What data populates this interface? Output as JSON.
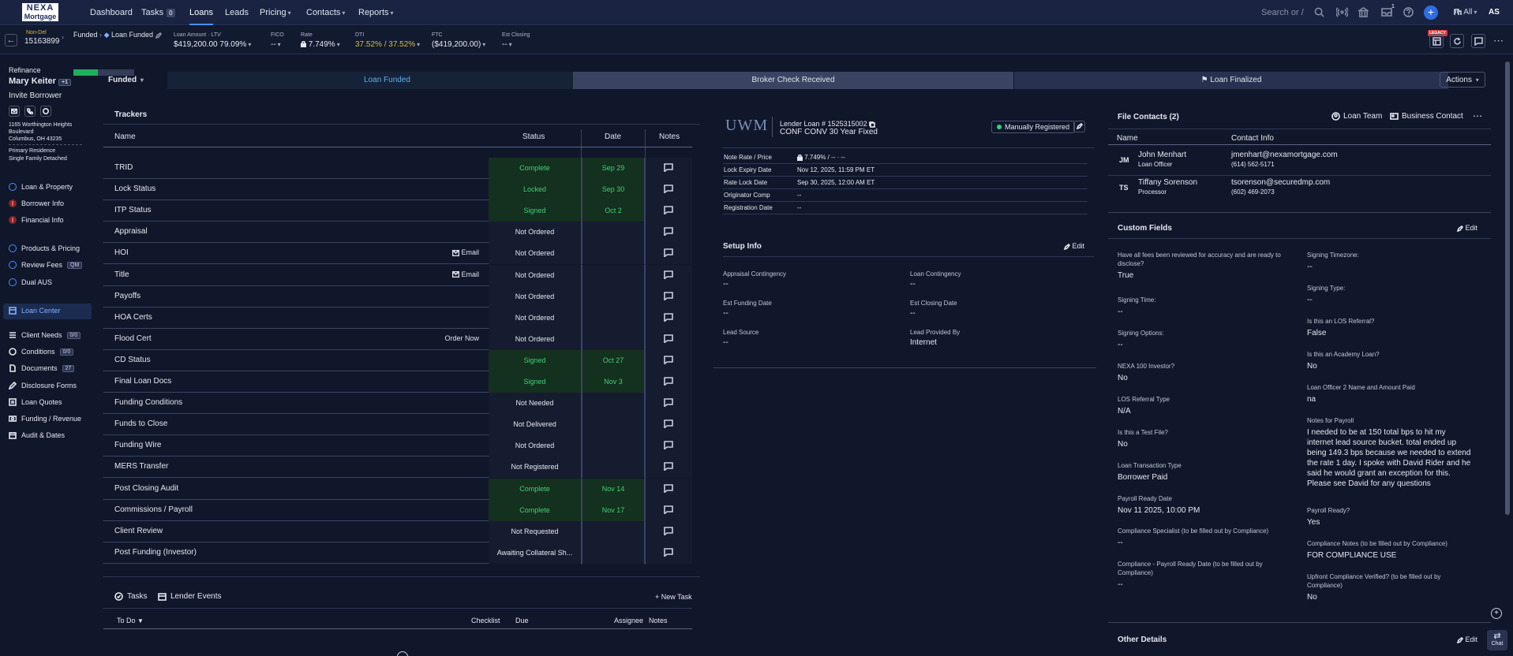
{
  "nav": {
    "logo": "NEXA",
    "logo_sub": "Mortgage",
    "items": [
      {
        "label": "Dashboard",
        "name": "nav-dashboard"
      },
      {
        "label": "Tasks",
        "name": "nav-tasks",
        "count": "0"
      },
      {
        "label": "Loans",
        "name": "nav-loans"
      },
      {
        "label": "Leads",
        "name": "nav-leads"
      },
      {
        "label": "Pricing",
        "name": "nav-pricing"
      },
      {
        "label": "Contacts",
        "name": "nav-contacts"
      },
      {
        "label": "Reports",
        "name": "nav-reports"
      }
    ],
    "search_placeholder": "Search or /",
    "scope": "All",
    "user_initials": "AS",
    "notif_count": "1"
  },
  "loan": {
    "tag": "Non-Del",
    "number": "15163899",
    "stage_path": "Funded",
    "stage_current": "Loan Funded",
    "progress_pct": 40,
    "fields": [
      {
        "label": "Loan Amount  ·  LTV",
        "value": "$419,200.00  79.09%"
      },
      {
        "label": "FICO",
        "value": "--"
      },
      {
        "label": "Rate",
        "value": "7.749%"
      },
      {
        "label": "DTI",
        "value": "37.52% / 37.52%"
      },
      {
        "label": "FTC",
        "value": "($419,200.00)"
      },
      {
        "label": "Est Closing",
        "value": "--"
      }
    ],
    "legacy": "LEGACY"
  },
  "borrower": {
    "purpose": "Refinance",
    "name": "Mary Keiter",
    "extra": "+1",
    "invite": "Invite Borrower",
    "addr1": "1165 Worthington Heights",
    "addr2": "Boulevard",
    "addr3": "Columbus, OH 43235",
    "occupancy": "Primary Residence",
    "property_type": "Single Family Detached"
  },
  "sidebar": {
    "group1": [
      "Loan & Property",
      "Borrower Info",
      "Financial Info"
    ],
    "group2": [
      "Products & Pricing",
      "Review Fees",
      "Dual AUS"
    ],
    "review_badge": "QM",
    "loan_center": "Loan Center",
    "group3": [
      {
        "label": "Client Needs",
        "count": "0/0"
      },
      {
        "label": "Conditions",
        "count": "0/0"
      },
      {
        "label": "Documents",
        "count": "27"
      },
      {
        "label": "Disclosure Forms"
      },
      {
        "label": "Loan Quotes"
      },
      {
        "label": "Funding / Revenue"
      },
      {
        "label": "Audit & Dates"
      }
    ]
  },
  "stages": {
    "dropdown": "Funded",
    "s1": "Loan Funded",
    "s2": "Broker Check Received",
    "s3": "Loan Finalized",
    "actions": "Actions"
  },
  "trackers": {
    "title": "Trackers",
    "headers": {
      "name": "Name",
      "status": "Status",
      "date": "Date",
      "notes": "Notes"
    },
    "rows": [
      {
        "name": "TRID",
        "status": "Complete",
        "date": "Sep 29",
        "green": true
      },
      {
        "name": "Lock Status",
        "status": "Locked",
        "date": "Sep 30",
        "green": true
      },
      {
        "name": "ITP Status",
        "status": "Signed",
        "date": "Oct 2",
        "green": true
      },
      {
        "name": "Appraisal",
        "status": "Not Ordered",
        "date": ""
      },
      {
        "name": "HOI",
        "status": "Not Ordered",
        "date": "",
        "action": "Email"
      },
      {
        "name": "Title",
        "status": "Not Ordered",
        "date": "",
        "action": "Email"
      },
      {
        "name": "Payoffs",
        "status": "Not Ordered",
        "date": ""
      },
      {
        "name": "HOA Certs",
        "status": "Not Ordered",
        "date": ""
      },
      {
        "name": "Flood Cert",
        "status": "Not Ordered",
        "date": "",
        "action": "Order Now"
      },
      {
        "name": "CD Status",
        "status": "Signed",
        "date": "Oct 27",
        "green": true
      },
      {
        "name": "Final Loan Docs",
        "status": "Signed",
        "date": "Nov 3",
        "green": true
      },
      {
        "name": "Funding Conditions",
        "status": "Not Needed",
        "date": ""
      },
      {
        "name": "Funds to Close",
        "status": "Not Delivered",
        "date": ""
      },
      {
        "name": "Funding Wire",
        "status": "Not Ordered",
        "date": ""
      },
      {
        "name": "MERS Transfer",
        "status": "Not Registered",
        "date": ""
      },
      {
        "name": "Post Closing Audit",
        "status": "Complete",
        "date": "Nov 14",
        "green": true
      },
      {
        "name": "Commissions / Payroll",
        "status": "Complete",
        "date": "Nov 17",
        "green": true
      },
      {
        "name": "Client Review",
        "status": "Not Requested",
        "date": ""
      },
      {
        "name": "Post Funding (Investor)",
        "status": "Awaiting Collateral Sh...",
        "date": ""
      }
    ]
  },
  "tasks": {
    "tab1": "Tasks",
    "tab2": "Lender Events",
    "new_task": "New Task",
    "filter": "To Do",
    "cols": [
      "Checklist",
      "Due",
      "Assignee",
      "Notes"
    ]
  },
  "lender": {
    "logo": "UWM",
    "loan_no": "Lender Loan # 1525315002",
    "product": "CONF CONV 30 Year Fixed",
    "registered": "Manually Registered",
    "rows": [
      {
        "label": "Note Rate / Price",
        "value": "7.749%  /  --  ·  --"
      },
      {
        "label": "Lock Expiry Date",
        "value": "Nov 12, 2025, 11:59 PM ET"
      },
      {
        "label": "Rate Lock Date",
        "value": "Sep 30, 2025, 12:00 AM ET"
      },
      {
        "label": "Originator Comp",
        "value": "--"
      },
      {
        "label": "Registration Date",
        "value": "--"
      }
    ],
    "setup_title": "Setup Info",
    "edit": "Edit",
    "setup": [
      {
        "label": "Appraisal Contingency",
        "value": "--"
      },
      {
        "label": "Loan Contingency",
        "value": "--"
      },
      {
        "label": "Est Funding Date",
        "value": "--"
      },
      {
        "label": "Est Closing Date",
        "value": "--"
      },
      {
        "label": "Lead Source",
        "value": "--"
      },
      {
        "label": "Lead Provided By",
        "value": "Internet"
      }
    ]
  },
  "contacts": {
    "title": "File Contacts (2)",
    "loan_team": "Loan Team",
    "business_contact": "Business Contact",
    "headers": {
      "name": "Name",
      "info": "Contact Info"
    },
    "rows": [
      {
        "initials": "JM",
        "name": "John Menhart",
        "role": "Loan Officer",
        "email": "jmenhart@nexamortgage.com",
        "phone": "(614) 562-5171"
      },
      {
        "initials": "TS",
        "name": "Tiffany Sorenson",
        "role": "Processor",
        "email": "tsorenson@securedmp.com",
        "phone": "(602) 469-2073"
      }
    ]
  },
  "custom": {
    "title": "Custom Fields",
    "edit": "Edit",
    "left": [
      {
        "label": "Have all fees been reviewed for accuracy and are ready to disclose?",
        "value": "True"
      },
      {
        "label": "Signing Time:",
        "value": "--"
      },
      {
        "label": "Signing Options:",
        "value": "--"
      },
      {
        "label": "NEXA 100 Investor?",
        "value": "No"
      },
      {
        "label": "LOS Referral Type",
        "value": "N/A"
      },
      {
        "label": "Is this a Test File?",
        "value": "No"
      },
      {
        "label": "Loan Transaction Type",
        "value": "Borrower Paid"
      },
      {
        "label": "Payroll Ready Date",
        "value": "Nov 11 2025, 10:00 PM"
      },
      {
        "label": "Compliance Specialist (to be filled out by Compliance)",
        "value": "--"
      },
      {
        "label": "Compliance - Payroll Ready Date (to be filled out by Compliance)",
        "value": "--"
      }
    ],
    "right": [
      {
        "label": "Signing Timezone:",
        "value": "--"
      },
      {
        "label": "Signing Type:",
        "value": "--"
      },
      {
        "label": "Is this an LOS Referral?",
        "value": "False"
      },
      {
        "label": "Is this an Academy Loan?",
        "value": "No"
      },
      {
        "label": "Loan Officer 2 Name and Amount Paid",
        "value": "na"
      },
      {
        "label": "Notes for Payroll",
        "value": "I needed to be at 150 total bps to hit my internet lead source bucket. total ended up being 149.3 bps because we needed to extend the rate 1 day. I spoke with David Rider and he said he would grant an exception for this. Please see David for any questions"
      },
      {
        "label": "Payroll Ready?",
        "value": "Yes"
      },
      {
        "label": "Compliance Notes (to be filled out by Compliance)",
        "value": "FOR COMPLIANCE USE"
      },
      {
        "label": "Upfront Compliance Verified? (to be filled out by Compliance)",
        "value": "No"
      }
    ],
    "other": "Other Details",
    "other_edit": "Edit",
    "chat": "Chat"
  },
  "colors": {
    "accent": "#4d8ef7",
    "green": "#3fd079",
    "yellow": "#e0b93a",
    "bg": "#10172b"
  }
}
